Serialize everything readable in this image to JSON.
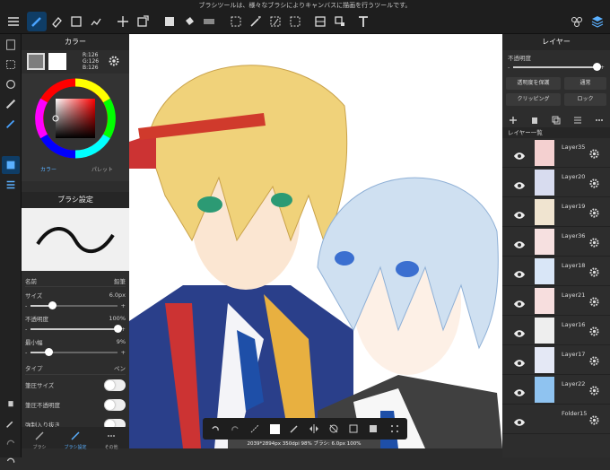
{
  "tooltip": "ブラシツールは、様々なブラシによりキャンバスに描画を行うツールです。",
  "color_panel": {
    "title": "カラー",
    "rgb": [
      "R:126",
      "G:126",
      "B:126"
    ],
    "primary_color": "#7e7e7e",
    "tabs": [
      "カラー",
      "パレット"
    ]
  },
  "brush_panel": {
    "title": "ブラシ設定",
    "name_label": "名前",
    "name_value": "鉛筆",
    "size_label": "サイズ",
    "size_value": "6.0px",
    "size_level": 0.25,
    "opacity_label": "不透明度",
    "opacity_value": "100%",
    "opacity_level": 1.0,
    "minwidth_label": "最小幅",
    "minwidth_value": "9%",
    "minwidth_level": 0.2,
    "type_label": "タイプ",
    "type_value": "ペン",
    "toggle1": "筆圧サイズ",
    "toggle2": "筆圧不透明度",
    "toggle3": "強制入り抜き",
    "minus": "-",
    "plus": "+"
  },
  "bottom_tabs": [
    "ブラシ",
    "ブラシ設定",
    "その他"
  ],
  "layer_panel": {
    "title": "レイヤー",
    "opacity_label": "不透明度",
    "opacity_level": 1.0,
    "protect_label": "透明度を保護",
    "blend_label": "通常",
    "clipping_label": "クリッピング",
    "lock_label": "ロック",
    "list_title": "レイヤー一覧",
    "layers": [
      {
        "name": "Layer35",
        "thumb": "#f4d0d0"
      },
      {
        "name": "Layer20",
        "thumb": "#d8dcef"
      },
      {
        "name": "Layer19",
        "thumb": "#f0e4d0"
      },
      {
        "name": "Layer36",
        "thumb": "#f6e0e0"
      },
      {
        "name": "Layer18",
        "thumb": "#d9e6f7"
      },
      {
        "name": "Layer21",
        "thumb": "#f7dede"
      },
      {
        "name": "Layer16",
        "thumb": "#eee"
      },
      {
        "name": "Layer17",
        "thumb": "#e4e8f5"
      },
      {
        "name": "Layer22",
        "thumb": "#8fc3f0"
      },
      {
        "name": "Folder15",
        "thumb": "#2d2d2d"
      }
    ]
  },
  "status": "2039*2894px 350dpi 98% ブラシ: 6.0px 100%"
}
